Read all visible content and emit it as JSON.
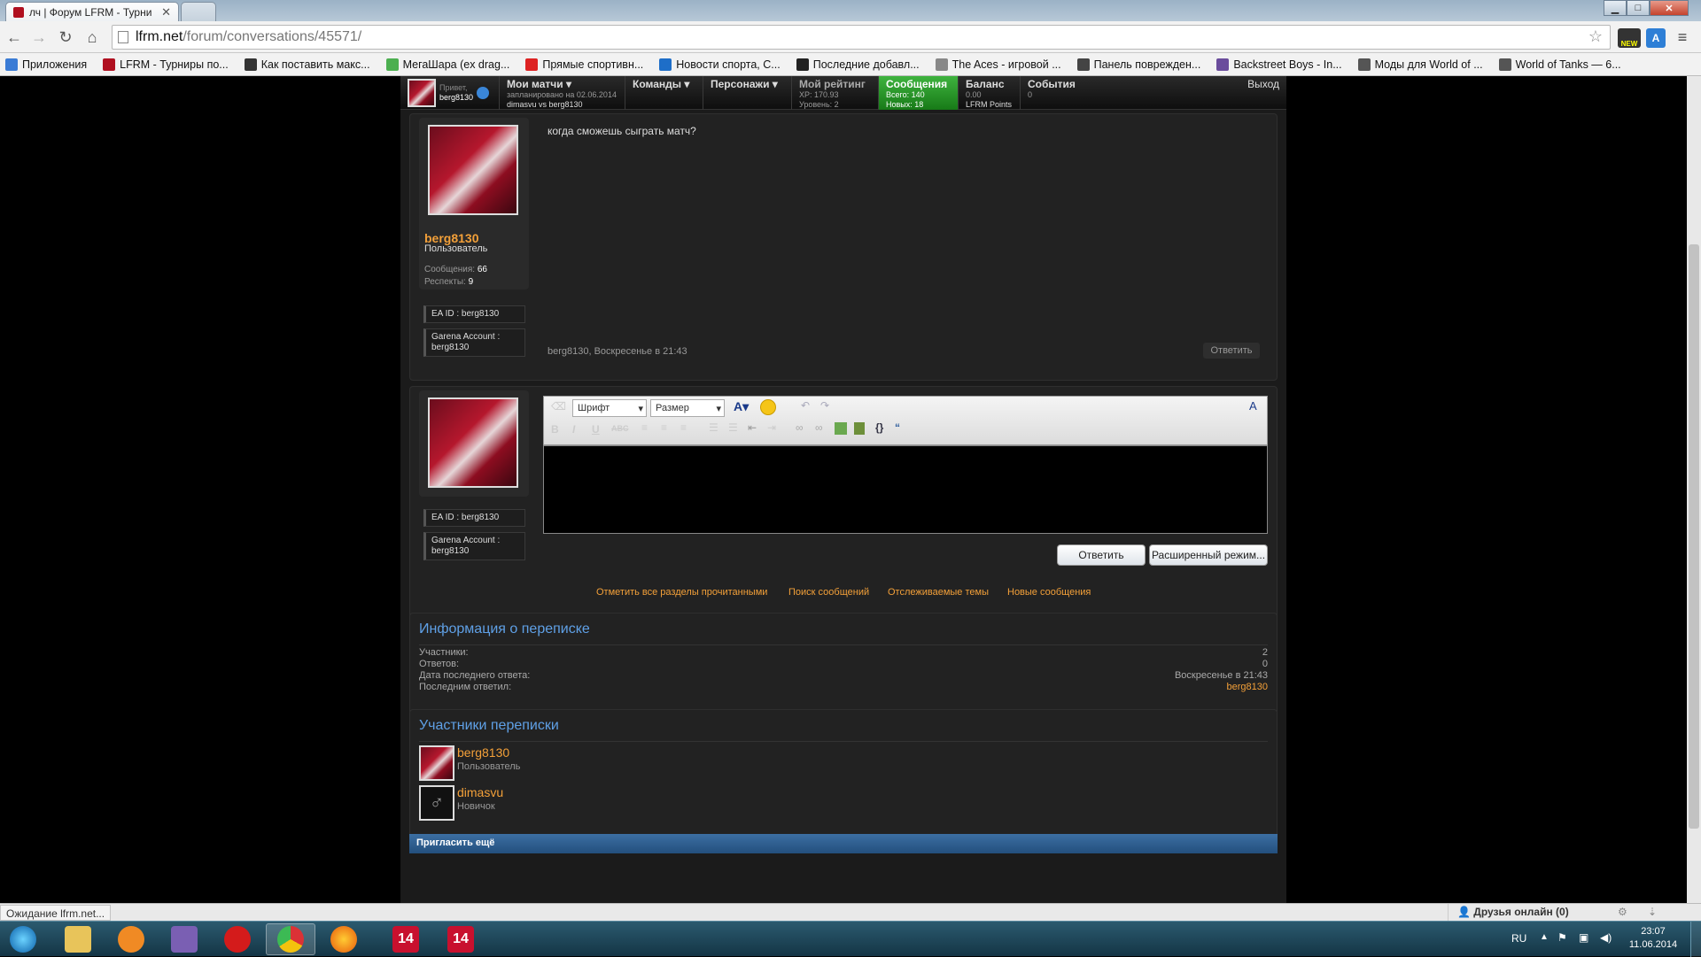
{
  "browser": {
    "tab_title": "лч | Форум LFRM - Турни",
    "url_host": "lfrm.net",
    "url_path": "/forum/conversations/45571/",
    "bookmarks": [
      "Приложения",
      "LFRM - Турниры по...",
      "Как поставить макс...",
      "МегаШара (ex drag...",
      "Прямые спортивн...",
      "Новости спорта, С...",
      "Последние добавл...",
      "The Aces - игровой ...",
      "Панель поврежден...",
      "Backstreet Boys - In...",
      "Моды для World of ...",
      "World of Tanks — 6..."
    ],
    "ext_badge": "NEW",
    "status_text": "Ожидание lfrm.net..."
  },
  "forumnav": {
    "greeting": "Привет,",
    "username": "berg8130",
    "matches_title": "Мои матчи",
    "matches_line1": "запланировано на 02.06.2014",
    "matches_line2": "dimasvu vs berg8130",
    "teams": "Команды",
    "characters": "Персонажи",
    "rating_title": "Мой рейтинг",
    "rating_xp": "XP: 170.93",
    "rating_level": "Уровень: 2",
    "messages_title": "Сообщения",
    "messages_total": "Всего: 140",
    "messages_new": "Новых: 18",
    "balance_title": "Баланс",
    "balance_value": "0.00",
    "balance_unit": "LFRM Points",
    "events_title": "События",
    "events_value": "0",
    "logout": "Выход"
  },
  "message": {
    "text": "когда сможешь сыграть матч?",
    "author": "berg8130",
    "role": "Пользователь",
    "stats_messages_label": "Сообщения:",
    "stats_messages_value": "66",
    "stats_respect_label": "Респекты:",
    "stats_respect_value": "9",
    "ea_id": "EA ID : berg8130",
    "garena_label": "Garena Account :",
    "garena_value": "berg8130",
    "meta": "berg8130, Воскресенье в 21:43",
    "reply": "Ответить"
  },
  "editor": {
    "font_placeholder": "Шрифт",
    "size_placeholder": "Размер",
    "ea_id": "EA ID : berg8130",
    "garena_label": "Garena Account :",
    "garena_value": "berg8130",
    "reply_button": "Ответить",
    "advanced_button": "Расширенный режим..."
  },
  "links": {
    "mark_read": "Отметить все разделы прочитанными",
    "search": "Поиск сообщений",
    "watched": "Отслеживаемые темы",
    "new_messages": "Новые сообщения"
  },
  "info": {
    "title": "Информация о переписке",
    "participants_label": "Участники:",
    "participants_value": "2",
    "replies_label": "Ответов:",
    "replies_value": "0",
    "last_date_label": "Дата последнего ответа:",
    "last_date_value": "Воскресенье в 21:43",
    "last_by_label": "Последним ответил:",
    "last_by_value": "berg8130"
  },
  "participants": {
    "title": "Участники переписки",
    "list": [
      {
        "name": "berg8130",
        "role": "Пользователь"
      },
      {
        "name": "dimasvu",
        "role": "Новичок"
      }
    ],
    "invite": "Пригласить ещё"
  },
  "status": {
    "friends_online": "Друзья онлайн (0)"
  },
  "taskbar": {
    "lang": "RU",
    "time": "23:07",
    "date": "11.06.2014",
    "badge1": "14",
    "badge2": "14"
  },
  "colors": {
    "accent_orange": "#f3a039",
    "heading_blue": "#5fa0e6",
    "nav_green": "#2a9a2a",
    "invite_bar": "#2f5b8a"
  }
}
